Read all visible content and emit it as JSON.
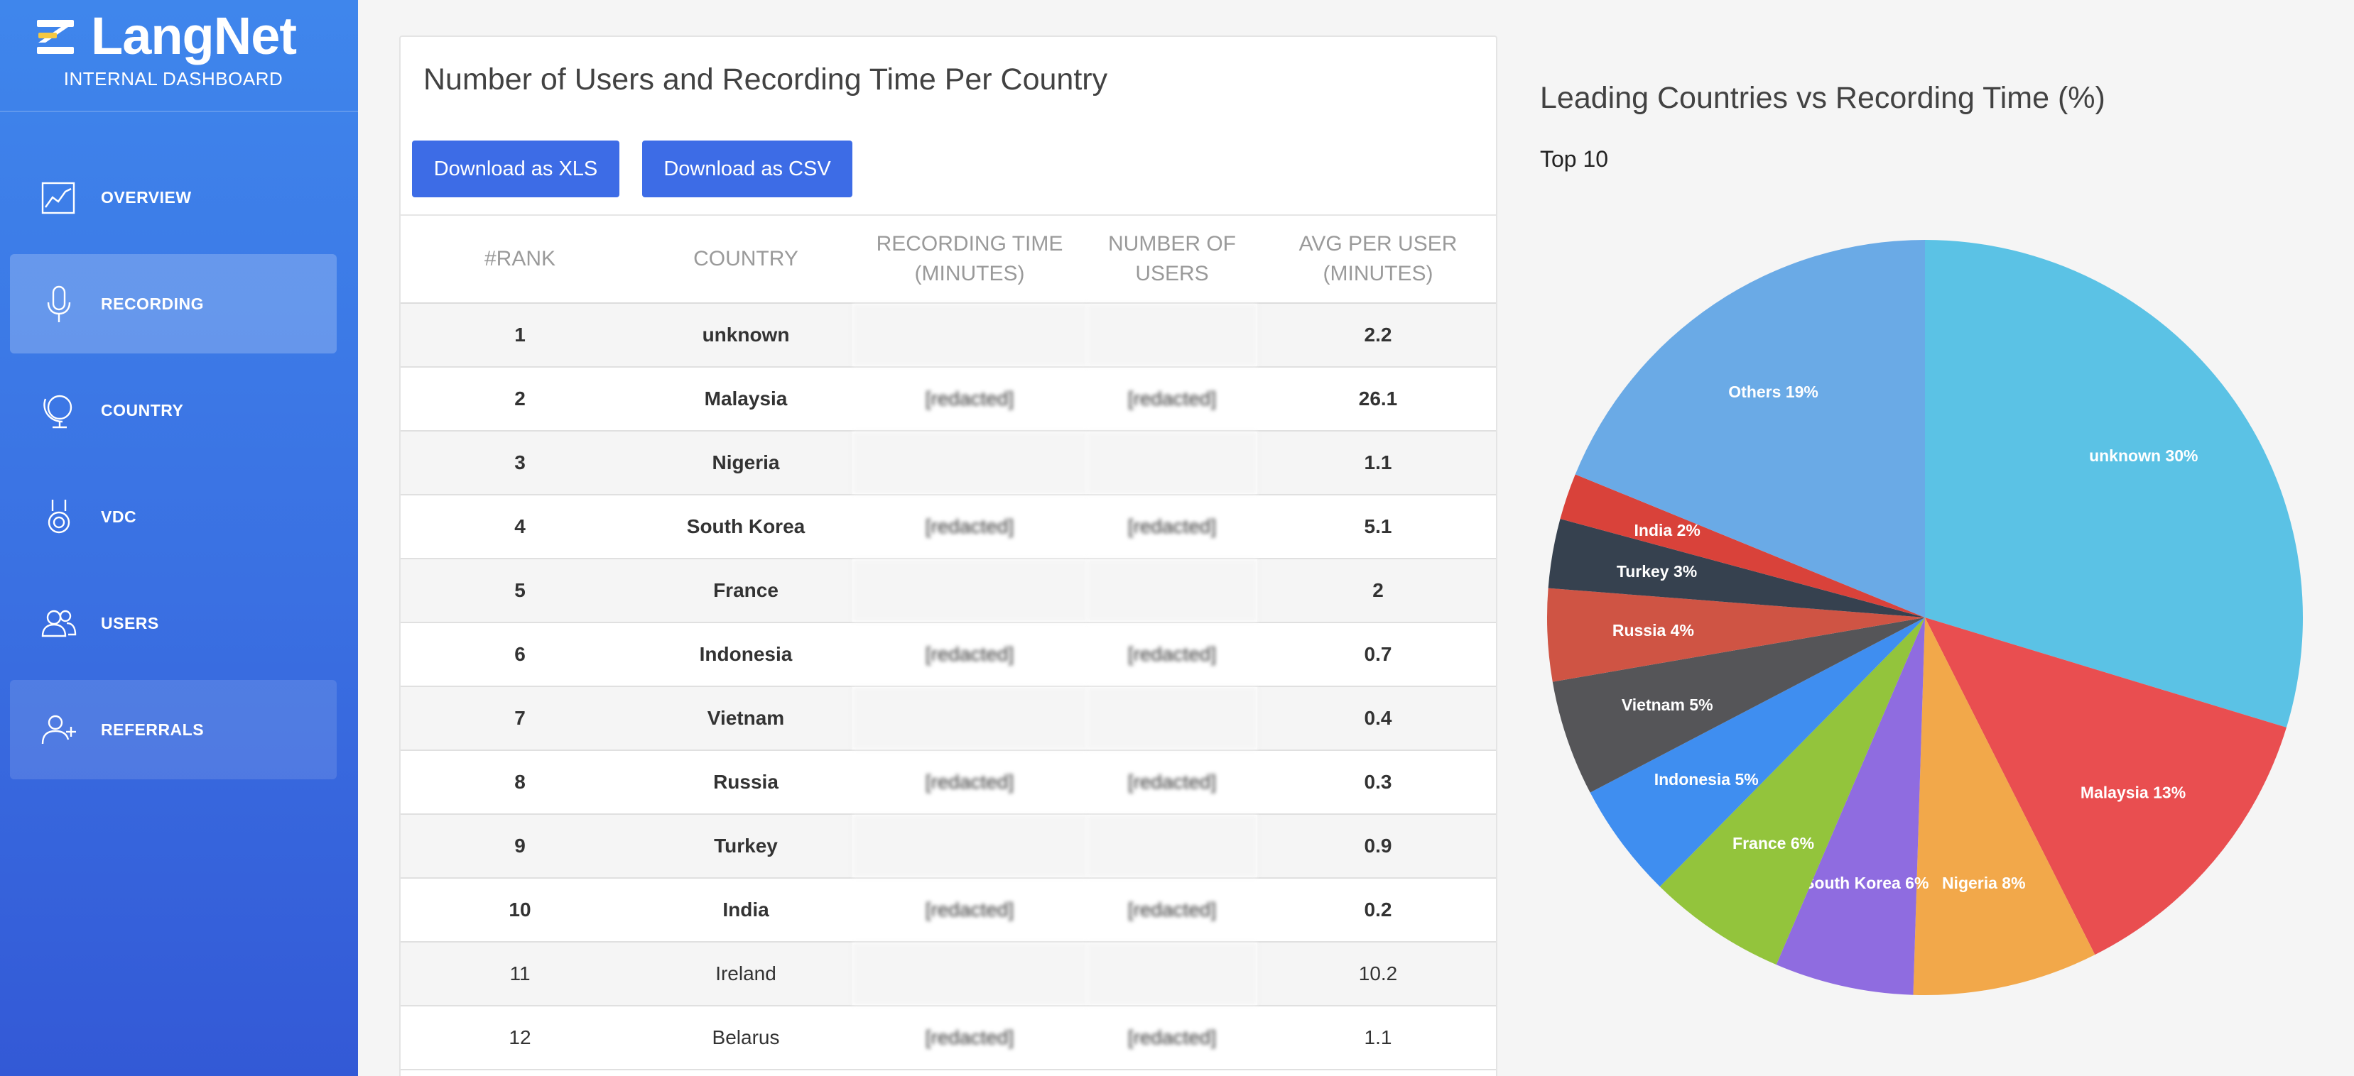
{
  "brand": {
    "name": "LangNet",
    "subtitle": "INTERNAL DASHBOARD"
  },
  "sidebar": {
    "items": [
      {
        "label": "OVERVIEW",
        "icon": "chart-line-icon"
      },
      {
        "label": "RECORDING",
        "icon": "microphone-icon",
        "active": true
      },
      {
        "label": "COUNTRY",
        "icon": "globe-icon"
      },
      {
        "label": "VDC",
        "icon": "medal-icon"
      },
      {
        "label": "USERS",
        "icon": "users-icon"
      },
      {
        "label": "REFERRALS",
        "icon": "user-plus-icon"
      }
    ]
  },
  "table_card": {
    "title": "Number of Users and Recording Time Per Country",
    "download_xls": "Download as XLS",
    "download_csv": "Download as CSV",
    "headers": {
      "rank": "#RANK",
      "country": "COUNTRY",
      "recording_time_1": "RECORDING TIME",
      "recording_time_2": "(MINUTES)",
      "number_of_users_1": "NUMBER OF",
      "number_of_users_2": "USERS",
      "avg_per_user_1": "AVG PER USER",
      "avg_per_user_2": "(MINUTES)"
    },
    "rows": [
      {
        "rank": "1",
        "country": "unknown",
        "recording_time": "",
        "users": "",
        "avg": "2.2"
      },
      {
        "rank": "2",
        "country": "Malaysia",
        "recording_time": "[redacted]",
        "users": "[redacted]",
        "avg": "26.1"
      },
      {
        "rank": "3",
        "country": "Nigeria",
        "recording_time": "",
        "users": "",
        "avg": "1.1"
      },
      {
        "rank": "4",
        "country": "South Korea",
        "recording_time": "[redacted]",
        "users": "[redacted]",
        "avg": "5.1"
      },
      {
        "rank": "5",
        "country": "France",
        "recording_time": "",
        "users": "",
        "avg": "2"
      },
      {
        "rank": "6",
        "country": "Indonesia",
        "recording_time": "[redacted]",
        "users": "[redacted]",
        "avg": "0.7"
      },
      {
        "rank": "7",
        "country": "Vietnam",
        "recording_time": "",
        "users": "",
        "avg": "0.4"
      },
      {
        "rank": "8",
        "country": "Russia",
        "recording_time": "[redacted]",
        "users": "[redacted]",
        "avg": "0.3"
      },
      {
        "rank": "9",
        "country": "Turkey",
        "recording_time": "",
        "users": "",
        "avg": "0.9"
      },
      {
        "rank": "10",
        "country": "India",
        "recording_time": "[redacted]",
        "users": "[redacted]",
        "avg": "0.2"
      },
      {
        "rank": "11",
        "country": "Ireland",
        "recording_time": "",
        "users": "",
        "avg": "10.2"
      },
      {
        "rank": "12",
        "country": "Belarus",
        "recording_time": "[redacted]",
        "users": "[redacted]",
        "avg": "1.1"
      }
    ]
  },
  "chart_data": {
    "type": "pie",
    "title": "Leading Countries vs Recording Time (%)",
    "subtitle": "Top 10",
    "slices": [
      {
        "label": "unknown 30%",
        "value": 30,
        "color": "#5bc2e5"
      },
      {
        "label": "Malaysia 13%",
        "value": 13,
        "color": "#e94e50"
      },
      {
        "label": "Nigeria 8%",
        "value": 8,
        "color": "#f2a84a"
      },
      {
        "label": "South Korea 6%",
        "value": 6,
        "color": "#8f6ce0"
      },
      {
        "label": "France 6%",
        "value": 6,
        "color": "#93c43c"
      },
      {
        "label": "Indonesia 5%",
        "value": 5,
        "color": "#3f8ef0"
      },
      {
        "label": "Vietnam 5%",
        "value": 5,
        "color": "#555558"
      },
      {
        "label": "Russia 4%",
        "value": 4,
        "color": "#cf5444"
      },
      {
        "label": "Turkey 3%",
        "value": 3,
        "color": "#36414f"
      },
      {
        "label": "India 2%",
        "value": 2,
        "color": "#d9423a"
      },
      {
        "label": "Others 19%",
        "value": 19,
        "color": "#6aaae6"
      }
    ]
  }
}
